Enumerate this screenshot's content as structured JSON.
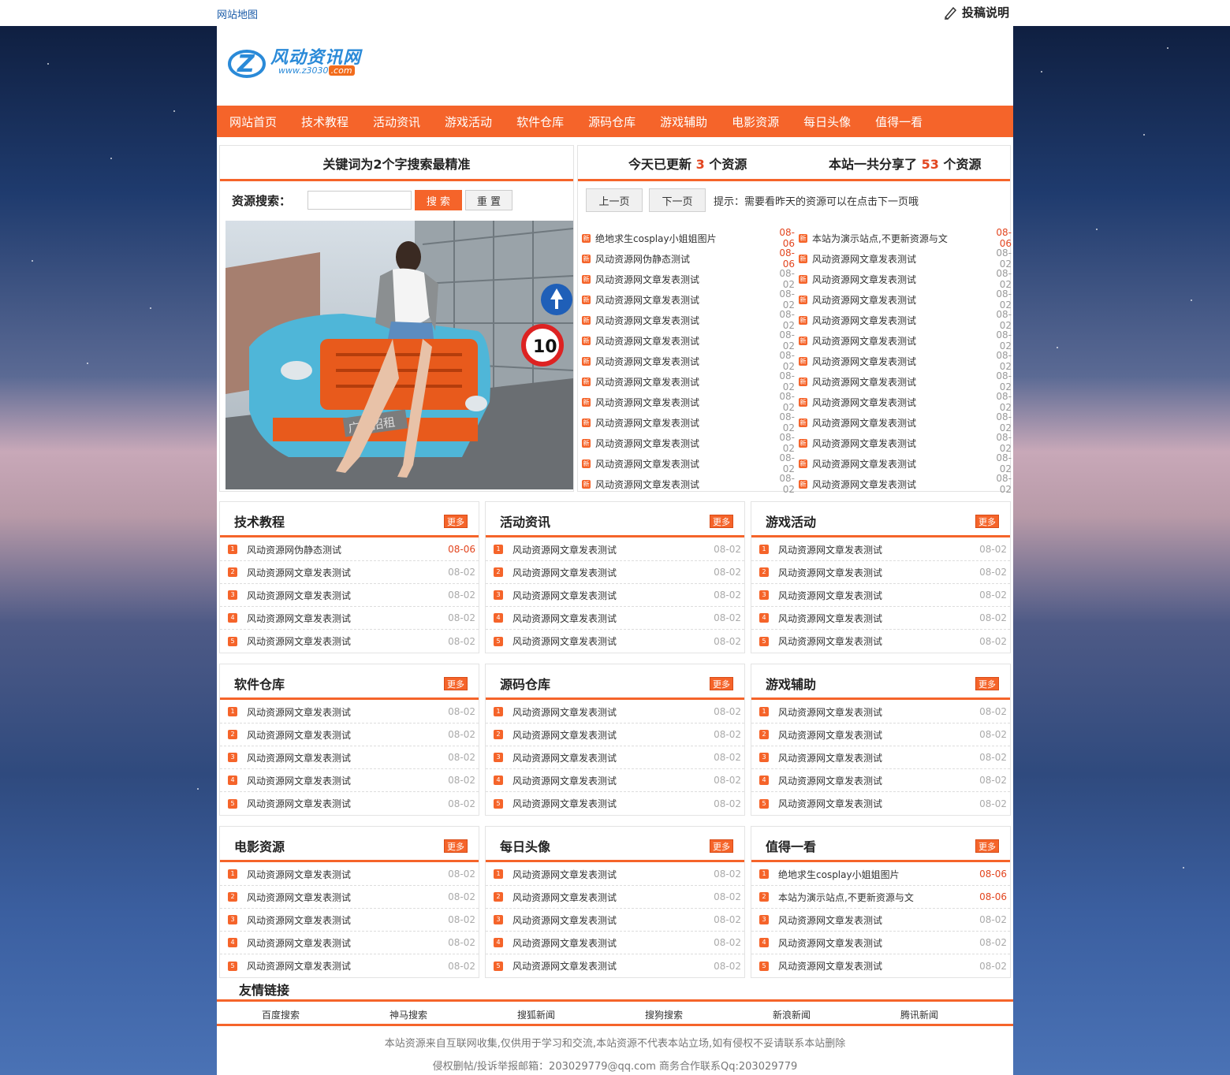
{
  "topbar": {
    "sitemap": "网站地图",
    "contribute": "投稿说明"
  },
  "logo": {
    "name": "风动资讯网",
    "url_prefix": "www.z3030",
    "url_suffix": ".com"
  },
  "nav": [
    "网站首页",
    "技术教程",
    "活动资讯",
    "游戏活动",
    "软件仓库",
    "源码仓库",
    "游戏辅助",
    "电影资源",
    "每日头像",
    "值得一看"
  ],
  "search": {
    "title": "关键词为2个字搜索最精准",
    "label": "资源搜索：",
    "input_value": "",
    "search_btn": "搜 索",
    "reset_btn": "重 置"
  },
  "ad": {
    "caption": "广告招租",
    "sign_number": "10"
  },
  "stats": {
    "today_prefix": "今天已更新",
    "today_count": "3",
    "today_suffix": "个资源",
    "total_prefix": "本站一共分享了",
    "total_count": "53",
    "total_suffix": "个资源"
  },
  "pager": {
    "prev": "上一页",
    "next": "下一页",
    "tip": "提示：需要看昨天的资源可以在点击下一页哦"
  },
  "new_badge": "新",
  "latest_left": [
    {
      "title": "绝地求生cosplay小姐姐图片",
      "date": "08-06",
      "hot": true
    },
    {
      "title": "风动资源网伪静态测试",
      "date": "08-06",
      "hot": true
    },
    {
      "title": "风动资源网文章发表测试",
      "date": "08-02",
      "hot": false
    },
    {
      "title": "风动资源网文章发表测试",
      "date": "08-02",
      "hot": false
    },
    {
      "title": "风动资源网文章发表测试",
      "date": "08-02",
      "hot": false
    },
    {
      "title": "风动资源网文章发表测试",
      "date": "08-02",
      "hot": false
    },
    {
      "title": "风动资源网文章发表测试",
      "date": "08-02",
      "hot": false
    },
    {
      "title": "风动资源网文章发表测试",
      "date": "08-02",
      "hot": false
    },
    {
      "title": "风动资源网文章发表测试",
      "date": "08-02",
      "hot": false
    },
    {
      "title": "风动资源网文章发表测试",
      "date": "08-02",
      "hot": false
    },
    {
      "title": "风动资源网文章发表测试",
      "date": "08-02",
      "hot": false
    },
    {
      "title": "风动资源网文章发表测试",
      "date": "08-02",
      "hot": false
    },
    {
      "title": "风动资源网文章发表测试",
      "date": "08-02",
      "hot": false
    }
  ],
  "latest_right": [
    {
      "title": "本站为演示站点,不更新资源与文",
      "date": "08-06",
      "hot": true
    },
    {
      "title": "风动资源网文章发表测试",
      "date": "08-02",
      "hot": false
    },
    {
      "title": "风动资源网文章发表测试",
      "date": "08-02",
      "hot": false
    },
    {
      "title": "风动资源网文章发表测试",
      "date": "08-02",
      "hot": false
    },
    {
      "title": "风动资源网文章发表测试",
      "date": "08-02",
      "hot": false
    },
    {
      "title": "风动资源网文章发表测试",
      "date": "08-02",
      "hot": false
    },
    {
      "title": "风动资源网文章发表测试",
      "date": "08-02",
      "hot": false
    },
    {
      "title": "风动资源网文章发表测试",
      "date": "08-02",
      "hot": false
    },
    {
      "title": "风动资源网文章发表测试",
      "date": "08-02",
      "hot": false
    },
    {
      "title": "风动资源网文章发表测试",
      "date": "08-02",
      "hot": false
    },
    {
      "title": "风动资源网文章发表测试",
      "date": "08-02",
      "hot": false
    },
    {
      "title": "风动资源网文章发表测试",
      "date": "08-02",
      "hot": false
    },
    {
      "title": "风动资源网文章发表测试",
      "date": "08-02",
      "hot": false
    }
  ],
  "more_label": "更多",
  "categories": [
    {
      "title": "技术教程",
      "items": [
        {
          "n": "1",
          "title": "风动资源网伪静态测试",
          "date": "08-06",
          "hot": true
        },
        {
          "n": "2",
          "title": "风动资源网文章发表测试",
          "date": "08-02",
          "hot": false
        },
        {
          "n": "3",
          "title": "风动资源网文章发表测试",
          "date": "08-02",
          "hot": false
        },
        {
          "n": "4",
          "title": "风动资源网文章发表测试",
          "date": "08-02",
          "hot": false
        },
        {
          "n": "5",
          "title": "风动资源网文章发表测试",
          "date": "08-02",
          "hot": false
        }
      ]
    },
    {
      "title": "活动资讯",
      "items": [
        {
          "n": "1",
          "title": "风动资源网文章发表测试",
          "date": "08-02",
          "hot": false
        },
        {
          "n": "2",
          "title": "风动资源网文章发表测试",
          "date": "08-02",
          "hot": false
        },
        {
          "n": "3",
          "title": "风动资源网文章发表测试",
          "date": "08-02",
          "hot": false
        },
        {
          "n": "4",
          "title": "风动资源网文章发表测试",
          "date": "08-02",
          "hot": false
        },
        {
          "n": "5",
          "title": "风动资源网文章发表测试",
          "date": "08-02",
          "hot": false
        }
      ]
    },
    {
      "title": "游戏活动",
      "items": [
        {
          "n": "1",
          "title": "风动资源网文章发表测试",
          "date": "08-02",
          "hot": false
        },
        {
          "n": "2",
          "title": "风动资源网文章发表测试",
          "date": "08-02",
          "hot": false
        },
        {
          "n": "3",
          "title": "风动资源网文章发表测试",
          "date": "08-02",
          "hot": false
        },
        {
          "n": "4",
          "title": "风动资源网文章发表测试",
          "date": "08-02",
          "hot": false
        },
        {
          "n": "5",
          "title": "风动资源网文章发表测试",
          "date": "08-02",
          "hot": false
        }
      ]
    },
    {
      "title": "软件仓库",
      "items": [
        {
          "n": "1",
          "title": "风动资源网文章发表测试",
          "date": "08-02",
          "hot": false
        },
        {
          "n": "2",
          "title": "风动资源网文章发表测试",
          "date": "08-02",
          "hot": false
        },
        {
          "n": "3",
          "title": "风动资源网文章发表测试",
          "date": "08-02",
          "hot": false
        },
        {
          "n": "4",
          "title": "风动资源网文章发表测试",
          "date": "08-02",
          "hot": false
        },
        {
          "n": "5",
          "title": "风动资源网文章发表测试",
          "date": "08-02",
          "hot": false
        }
      ]
    },
    {
      "title": "源码仓库",
      "items": [
        {
          "n": "1",
          "title": "风动资源网文章发表测试",
          "date": "08-02",
          "hot": false
        },
        {
          "n": "2",
          "title": "风动资源网文章发表测试",
          "date": "08-02",
          "hot": false
        },
        {
          "n": "3",
          "title": "风动资源网文章发表测试",
          "date": "08-02",
          "hot": false
        },
        {
          "n": "4",
          "title": "风动资源网文章发表测试",
          "date": "08-02",
          "hot": false
        },
        {
          "n": "5",
          "title": "风动资源网文章发表测试",
          "date": "08-02",
          "hot": false
        }
      ]
    },
    {
      "title": "游戏辅助",
      "items": [
        {
          "n": "1",
          "title": "风动资源网文章发表测试",
          "date": "08-02",
          "hot": false
        },
        {
          "n": "2",
          "title": "风动资源网文章发表测试",
          "date": "08-02",
          "hot": false
        },
        {
          "n": "3",
          "title": "风动资源网文章发表测试",
          "date": "08-02",
          "hot": false
        },
        {
          "n": "4",
          "title": "风动资源网文章发表测试",
          "date": "08-02",
          "hot": false
        },
        {
          "n": "5",
          "title": "风动资源网文章发表测试",
          "date": "08-02",
          "hot": false
        }
      ]
    },
    {
      "title": "电影资源",
      "items": [
        {
          "n": "1",
          "title": "风动资源网文章发表测试",
          "date": "08-02",
          "hot": false
        },
        {
          "n": "2",
          "title": "风动资源网文章发表测试",
          "date": "08-02",
          "hot": false
        },
        {
          "n": "3",
          "title": "风动资源网文章发表测试",
          "date": "08-02",
          "hot": false
        },
        {
          "n": "4",
          "title": "风动资源网文章发表测试",
          "date": "08-02",
          "hot": false
        },
        {
          "n": "5",
          "title": "风动资源网文章发表测试",
          "date": "08-02",
          "hot": false
        }
      ]
    },
    {
      "title": "每日头像",
      "items": [
        {
          "n": "1",
          "title": "风动资源网文章发表测试",
          "date": "08-02",
          "hot": false
        },
        {
          "n": "2",
          "title": "风动资源网文章发表测试",
          "date": "08-02",
          "hot": false
        },
        {
          "n": "3",
          "title": "风动资源网文章发表测试",
          "date": "08-02",
          "hot": false
        },
        {
          "n": "4",
          "title": "风动资源网文章发表测试",
          "date": "08-02",
          "hot": false
        },
        {
          "n": "5",
          "title": "风动资源网文章发表测试",
          "date": "08-02",
          "hot": false
        }
      ]
    },
    {
      "title": "值得一看",
      "items": [
        {
          "n": "1",
          "title": "绝地求生cosplay小姐姐图片",
          "date": "08-06",
          "hot": true
        },
        {
          "n": "2",
          "title": "本站为演示站点,不更新资源与文",
          "date": "08-06",
          "hot": true
        },
        {
          "n": "3",
          "title": "风动资源网文章发表测试",
          "date": "08-02",
          "hot": false
        },
        {
          "n": "4",
          "title": "风动资源网文章发表测试",
          "date": "08-02",
          "hot": false
        },
        {
          "n": "5",
          "title": "风动资源网文章发表测试",
          "date": "08-02",
          "hot": false
        }
      ]
    }
  ],
  "friends": {
    "title": "友情链接",
    "links": [
      "百度搜索",
      "神马搜索",
      "搜狐新闻",
      "搜狗搜索",
      "新浪新闻",
      "腾讯新闻"
    ]
  },
  "footer": {
    "disclaimer": "本站资源来自互联网收集,仅供用于学习和交流,本站资源不代表本站立场,如有侵权不妥请联系本站删除",
    "contact": "侵权删帖/投诉举报邮箱：203029779@qq.com 商务合作联系Qq:203029779"
  },
  "colors": {
    "accent": "#f5642a",
    "hot_date": "#e2451f",
    "link_blue": "#1a5ba8"
  }
}
